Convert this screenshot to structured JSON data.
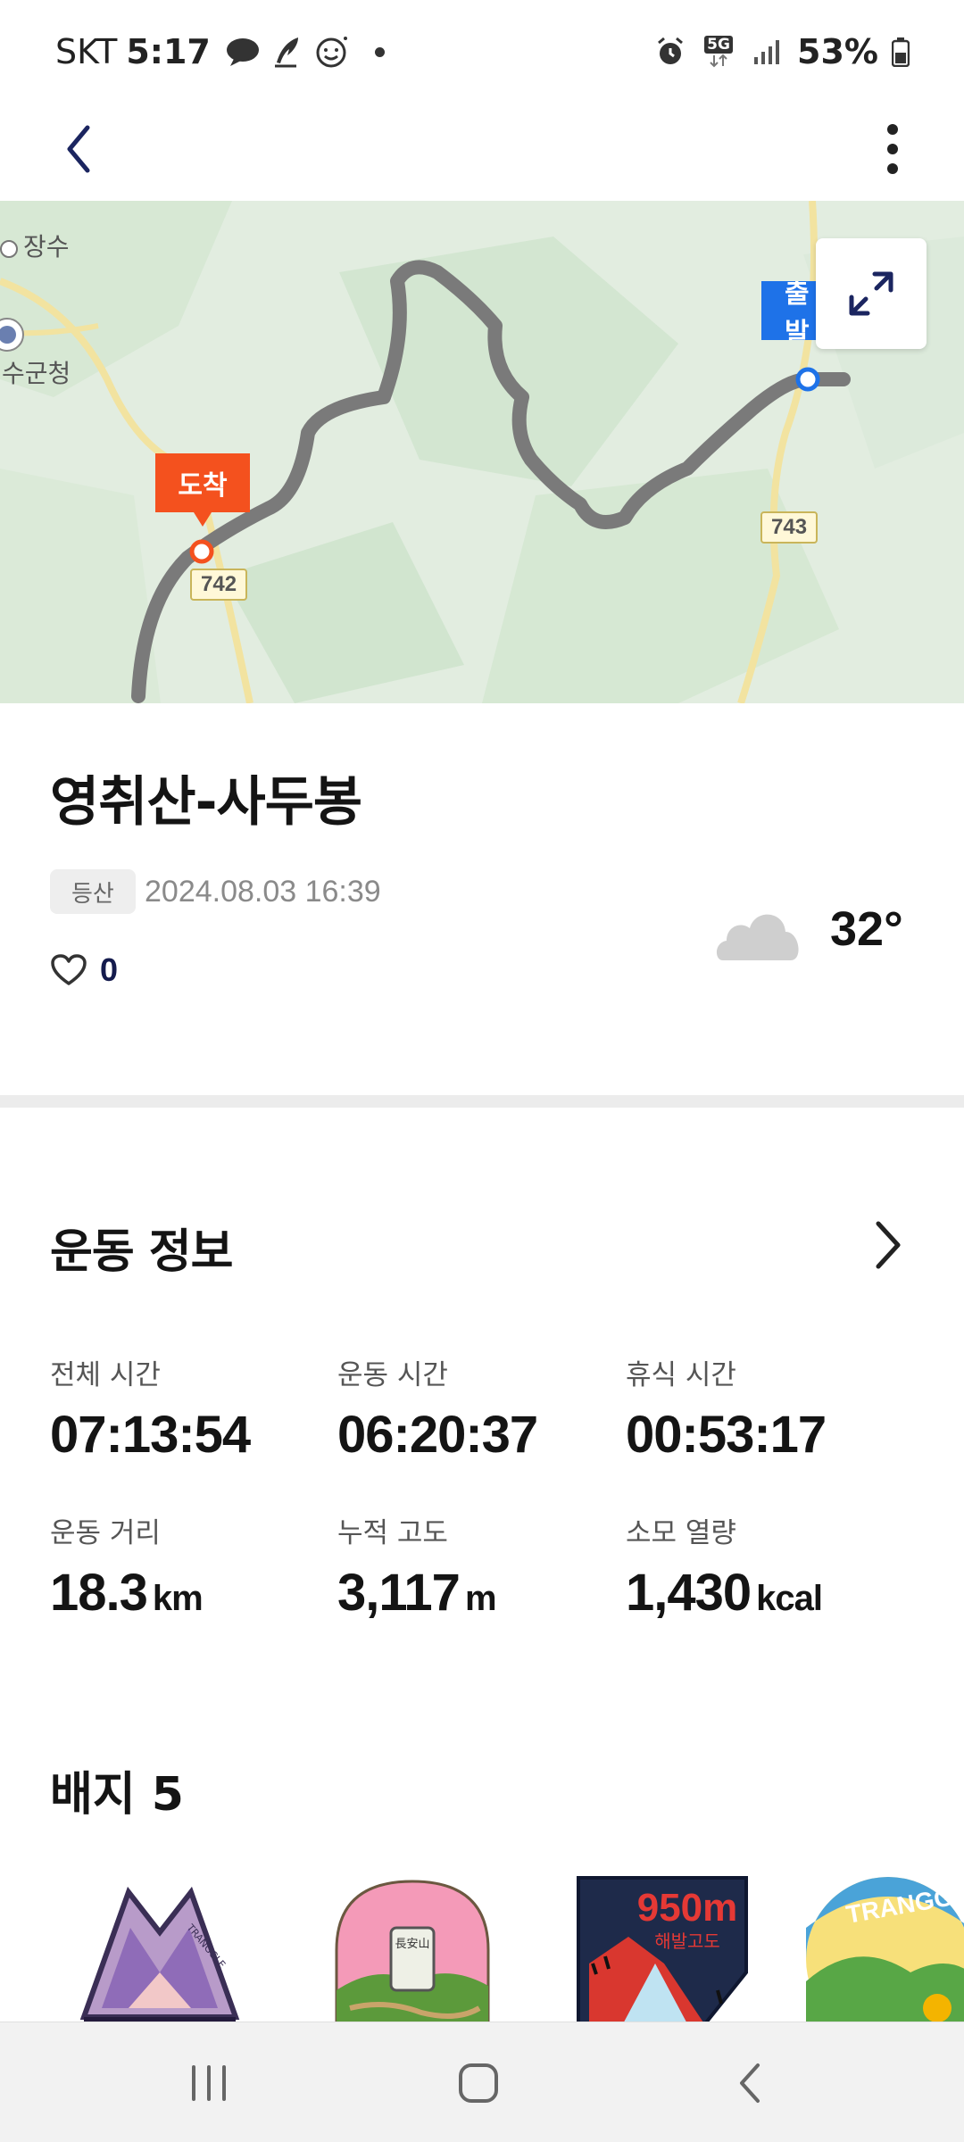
{
  "status_bar": {
    "carrier": "SKT",
    "time": "5:17",
    "network": "5G",
    "battery": "53%",
    "icons": [
      "chat-bubble-icon",
      "quill-icon",
      "smile-icon",
      "alarm-icon",
      "signal-icon",
      "battery-icon"
    ]
  },
  "app_bar": {
    "back_icon": "chevron-left-icon",
    "more_icon": "more-vertical-icon"
  },
  "map": {
    "start_label": "출발",
    "arrive_label": "도착",
    "road_labels": [
      "742",
      "743"
    ],
    "place_labels": [
      "장수",
      "수군청"
    ],
    "expand_icon": "expand-icon",
    "route_color": "#7a7a7a",
    "start_color": "#1e72e8",
    "arrive_color": "#f4511e"
  },
  "activity": {
    "title": "영취산-사두봉",
    "tag": "등산",
    "datetime": "2024.08.03 16:39",
    "likes": "0",
    "weather_icon": "cloud-icon",
    "temperature": "32°"
  },
  "exercise_info": {
    "title": "운동 정보",
    "stats": [
      {
        "label": "전체 시간",
        "value": "07:13:54",
        "unit": ""
      },
      {
        "label": "운동 시간",
        "value": "06:20:37",
        "unit": ""
      },
      {
        "label": "휴식 시간",
        "value": "00:53:17",
        "unit": ""
      },
      {
        "label": "운동 거리",
        "value": "18.3",
        "unit": "km"
      },
      {
        "label": "누적 고도",
        "value": "3,117",
        "unit": "m"
      },
      {
        "label": "소모 열량",
        "value": "1,430",
        "unit": "kcal"
      }
    ]
  },
  "badges": {
    "title": "배지 5",
    "items": [
      {
        "name": "tranggle-mountain-badge",
        "text": "TRANGGLE"
      },
      {
        "name": "jangan-mountain-badge",
        "text": "長安山"
      },
      {
        "name": "altitude-950-badge",
        "text": "950m",
        "subtext": "해발고도"
      },
      {
        "name": "tranggle-balloon-badge",
        "text": "TRANGG"
      }
    ]
  },
  "nav_bar": {
    "icons": [
      "recent-apps-icon",
      "home-icon",
      "back-icon"
    ]
  }
}
